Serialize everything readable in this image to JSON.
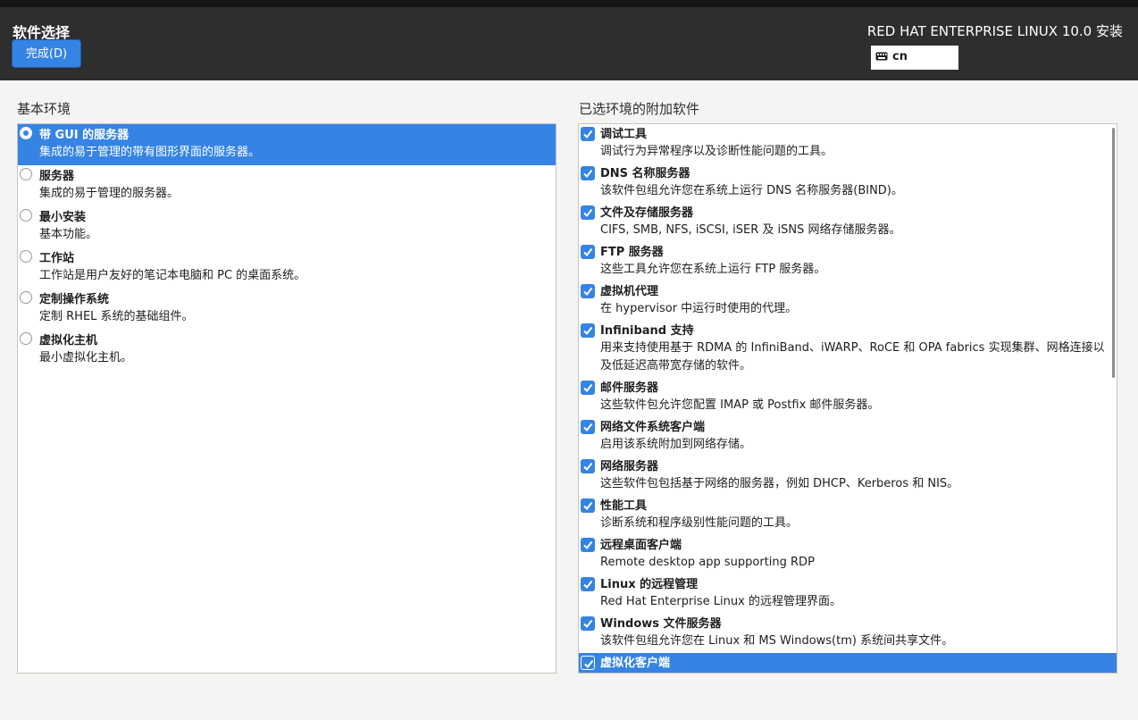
{
  "header": {
    "title": "软件选择",
    "done_label": "完成(D)",
    "product": "RED HAT ENTERPRISE LINUX 10.0 安装",
    "keyboard_layout": "cn"
  },
  "base_env": {
    "heading": "基本环境",
    "items": [
      {
        "name": "带 GUI 的服务器",
        "desc": "集成的易于管理的带有图形界面的服务器。"
      },
      {
        "name": "服务器",
        "desc": "集成的易于管理的服务器。"
      },
      {
        "name": "最小安装",
        "desc": "基本功能。"
      },
      {
        "name": "工作站",
        "desc": "工作站是用户友好的笔记本电脑和 PC 的桌面系统。"
      },
      {
        "name": "定制操作系统",
        "desc": "定制 RHEL 系统的基础组件。"
      },
      {
        "name": "虚拟化主机",
        "desc": "最小虚拟化主机。"
      }
    ]
  },
  "addons": {
    "heading": "已选环境的附加软件",
    "items": [
      {
        "name": "调试工具",
        "desc": "调试行为异常程序以及诊断性能问题的工具。"
      },
      {
        "name": "DNS 名称服务器",
        "desc": "该软件包组允许您在系统上运行 DNS 名称服务器(BIND)。"
      },
      {
        "name": "文件及存储服务器",
        "desc": "CIFS, SMB, NFS, iSCSI, iSER 及 iSNS 网络存储服务器。"
      },
      {
        "name": "FTP 服务器",
        "desc": "这些工具允许您在系统上运行 FTP 服务器。"
      },
      {
        "name": "虚拟机代理",
        "desc": "在 hypervisor 中运行时使用的代理。"
      },
      {
        "name": "Infiniband 支持",
        "desc": "用来支持使用基于 RDMA 的 InfiniBand、iWARP、RoCE 和 OPA fabrics 实现集群、网格连接以及低延迟高带宽存储的软件。"
      },
      {
        "name": "邮件服务器",
        "desc": "这些软件包允许您配置 IMAP 或 Postfix 邮件服务器。"
      },
      {
        "name": "网络文件系统客户端",
        "desc": "启用该系统附加到网络存储。"
      },
      {
        "name": "网络服务器",
        "desc": "这些软件包包括基于网络的服务器，例如 DHCP、Kerberos 和 NIS。"
      },
      {
        "name": "性能工具",
        "desc": "诊断系统和程序级别性能问题的工具。"
      },
      {
        "name": "远程桌面客户端",
        "desc": "Remote desktop app supporting RDP"
      },
      {
        "name": "Linux 的远程管理",
        "desc": "Red Hat Enterprise Linux 的远程管理界面。"
      },
      {
        "name": "Windows 文件服务器",
        "desc": "该软件包组允许您在 Linux 和 MS Windows(tm) 系统间共享文件。"
      },
      {
        "name": "虚拟化客户端",
        "desc": ""
      }
    ]
  }
}
